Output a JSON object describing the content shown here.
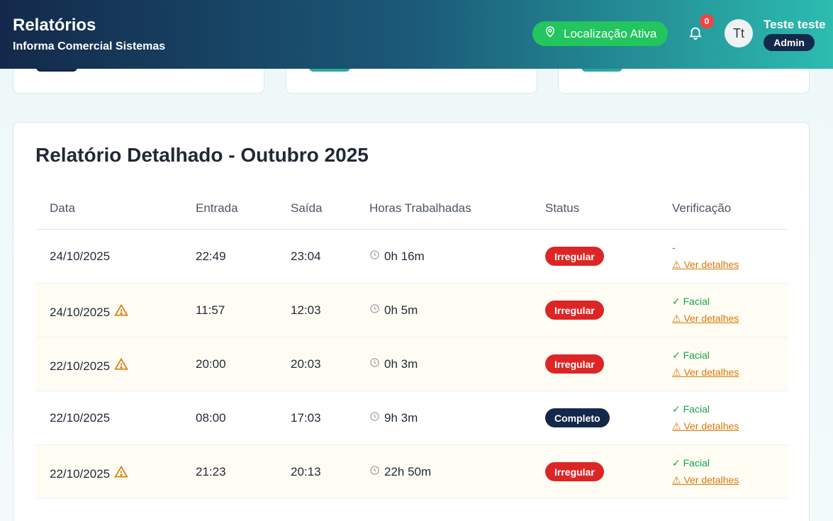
{
  "header": {
    "title": "Relatórios",
    "subtitle": "Informa Comercial Sistemas",
    "location_label": "Localização Ativa",
    "notification_count": "0",
    "avatar_initials": "Tt",
    "user_name": "Teste teste",
    "user_role": "Admin"
  },
  "colors": {
    "success": "#22c55e",
    "danger": "#dc2626",
    "navy": "#13294b",
    "warning": "#d97706"
  },
  "report": {
    "title": "Relatório Detalhado - Outubro 2025",
    "columns": [
      "Data",
      "Entrada",
      "Saída",
      "Horas Trabalhadas",
      "Status",
      "Verificação"
    ],
    "rows": [
      {
        "date": "24/10/2025",
        "warning": false,
        "in": "22:49",
        "out": "23:04",
        "hours": "0h 16m",
        "status": "Irregular",
        "verification": "-",
        "details": "⚠ Ver detalhes"
      },
      {
        "date": "24/10/2025",
        "warning": true,
        "in": "11:57",
        "out": "12:03",
        "hours": "0h 5m",
        "status": "Irregular",
        "verification": "✓ Facial",
        "details": "⚠ Ver detalhes"
      },
      {
        "date": "22/10/2025",
        "warning": true,
        "in": "20:00",
        "out": "20:03",
        "hours": "0h 3m",
        "status": "Irregular",
        "verification": "✓ Facial",
        "details": "⚠ Ver detalhes"
      },
      {
        "date": "22/10/2025",
        "warning": false,
        "in": "08:00",
        "out": "17:03",
        "hours": "9h 3m",
        "status": "Completo",
        "verification": "✓ Facial",
        "details": "⚠ Ver detalhes"
      },
      {
        "date": "22/10/2025",
        "warning": true,
        "in": "21:23",
        "out": "20:13",
        "hours": "22h 50m",
        "status": "Irregular",
        "verification": "✓ Facial",
        "details": "⚠ Ver detalhes"
      }
    ]
  }
}
